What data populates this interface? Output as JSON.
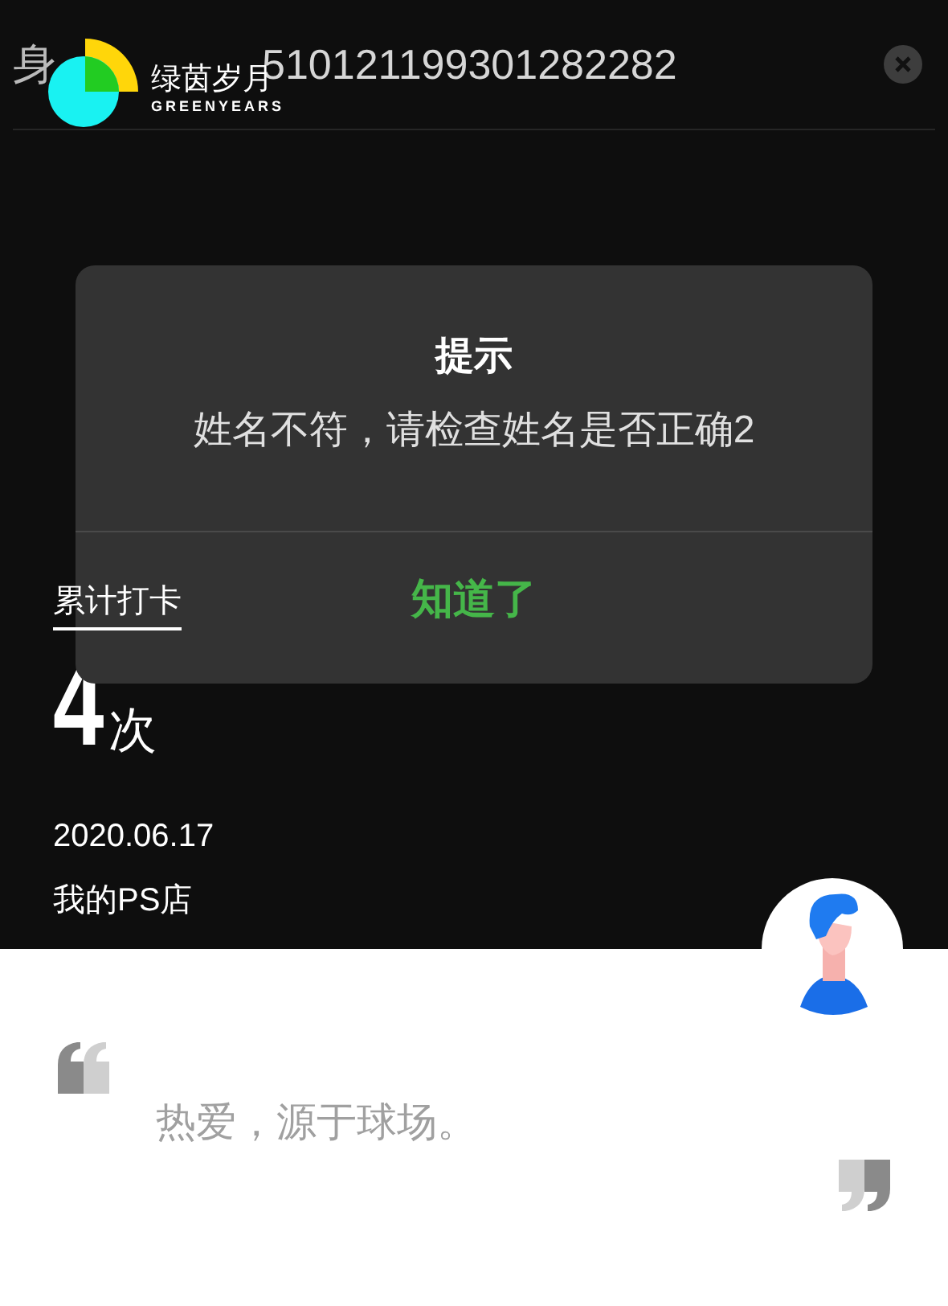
{
  "header": {
    "id_label": "身",
    "id_number": "510121199301282282",
    "logo": {
      "name": "绿茵岁月",
      "subtitle": "GREENYEARS"
    }
  },
  "stats": {
    "label": "累计打卡",
    "count": "4",
    "unit": "次",
    "date": "2020.06.17",
    "store": "我的PS店"
  },
  "motto": "热爱，源于球场。",
  "dialog": {
    "title": "提示",
    "message": "姓名不符，请检查姓名是否正确2",
    "button": "知道了"
  }
}
